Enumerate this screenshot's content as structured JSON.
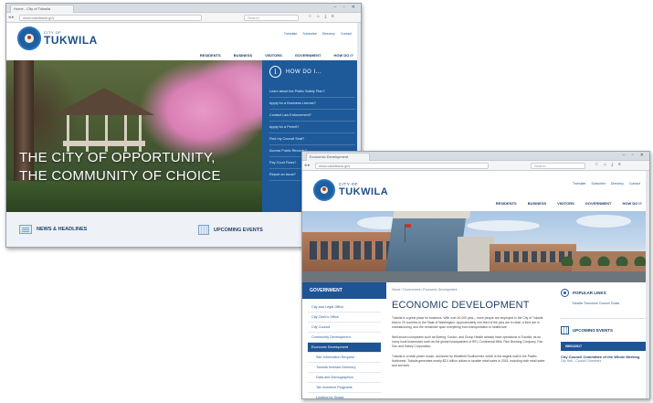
{
  "window1": {
    "tab_title": "Home - City of Tukwila",
    "url": "www.tukwilawa.gov",
    "search_placeholder": "Search",
    "logo": {
      "city_of": "CITY OF",
      "name": "TUKWILA"
    },
    "utility_links": [
      "Translate",
      "Subscribe",
      "Directory",
      "Contact"
    ],
    "nav": [
      "RESIDENTS",
      "BUSINESS",
      "VISITORS",
      "GOVERNMENT",
      "HOW DO I?"
    ],
    "hero": {
      "line1": "THE CITY OF OPPORTUNITY,",
      "line2": "THE COMMUNITY OF CHOICE"
    },
    "how_do_i": {
      "title": "HOW DO I...",
      "items": [
        "Learn about the Public Safety Plan?",
        "Apply for a Business License?",
        "Contact Law Enforcement?",
        "Apply for a Permit?",
        "Find my Council Seat?",
        "Access Public Records?",
        "Pay Court Fines?",
        "Report an Issue?"
      ]
    },
    "bottom": {
      "news": "NEWS & HEADLINES",
      "events": "UPCOMING EVENTS"
    }
  },
  "window2": {
    "tab_title": "Economic Development",
    "url": "www.tukwilawa.gov",
    "search_placeholder": "Search",
    "logo": {
      "city_of": "CITY OF",
      "name": "TUKWILA"
    },
    "utility_links": [
      "Translate",
      "Subscribe",
      "Directory",
      "Contact"
    ],
    "nav": [
      "RESIDENTS",
      "BUSINESS",
      "VISITORS",
      "GOVERNMENT",
      "HOW DO I?"
    ],
    "sidebar": {
      "title": "GOVERNMENT",
      "items": [
        {
          "label": "City and Legal Office",
          "state": "normal"
        },
        {
          "label": "City Clerk's Office",
          "state": "normal"
        },
        {
          "label": "City Council",
          "state": "normal"
        },
        {
          "label": "Community Development",
          "state": "normal"
        },
        {
          "label": "Economic Development",
          "state": "active"
        },
        {
          "label": "Site Information Request",
          "state": "sub"
        },
        {
          "label": "Tukwila Investor Directory",
          "state": "sub"
        },
        {
          "label": "Data and Demographics",
          "state": "sub"
        },
        {
          "label": "Tax Incentive Programs",
          "state": "sub"
        },
        {
          "label": "Looking for Space",
          "state": "sub"
        }
      ]
    },
    "content": {
      "breadcrumb": "Home / Government / Economic Development",
      "title": "ECONOMIC DEVELOPMENT",
      "paragraphs": [
        "Tukwila is a great place for business. With over 40,000 jobs – more people are employed in the City of Tukwila than in 29 counties in the State of Washington. Approximately one-third of the jobs are in retail, a third are in manufacturing, and the remainder span everything from transportation to healthcare.",
        "Well-known companies such as Boeing, Costco, and Group Health already have operations in Tukwila, as do many local businesses such as the global headquarters of REI, Continental Mills, Rich Brewing Company, Pan Geo and Sabey Corporation.",
        "Tukwila is a retail power house, anchored by Westfield Southcenter, which is the largest mall in the Pacific Northwest. Tukwila generates nearly $2.0 billion dollars in taxable retail sales in 2015, including both retail sales and services."
      ]
    },
    "rail": {
      "popular_title": "POPULAR LINKS",
      "popular_link": "Tukwila Tomorrow Council Goals",
      "events_title": "UPCOMING EVENTS",
      "event_date": "08/01/2017",
      "event_title": "City Council Committee of the Whole Meeting",
      "event_sub": "City Hall – Council Chambers"
    }
  }
}
